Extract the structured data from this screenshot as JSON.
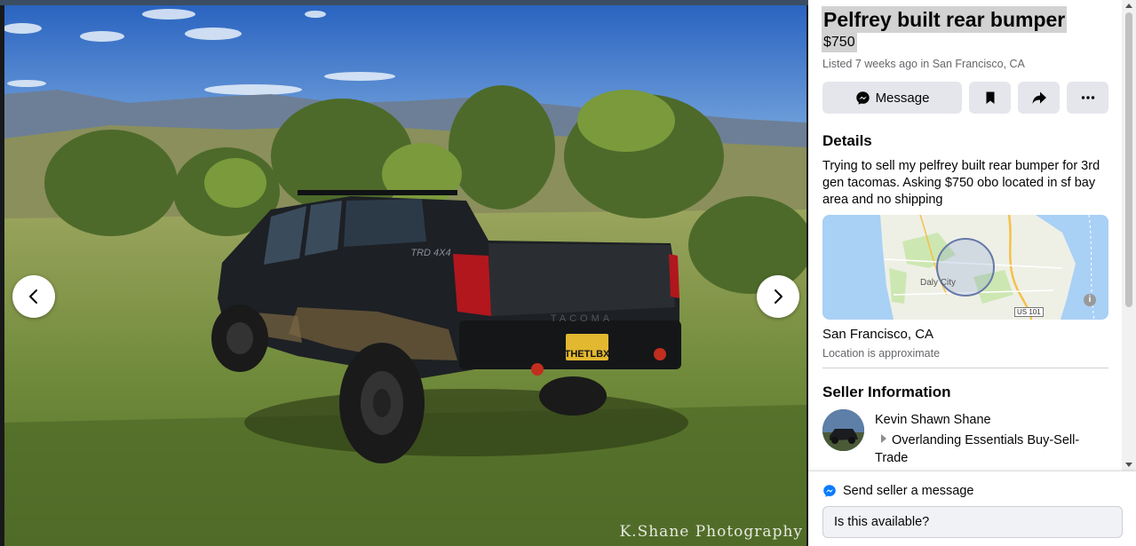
{
  "viewer": {
    "watermark": "K.Shane Photography",
    "plate": "THETLBX",
    "badge_trd": "TRD 4X4",
    "tailgate": "TACOMA",
    "prev_icon": "chevron-left-icon",
    "next_icon": "chevron-right-icon"
  },
  "listing": {
    "title": "Pelfrey built rear bumper",
    "price": "$750",
    "listed": "Listed 7 weeks ago in San Francisco, CA",
    "actions": {
      "message_label": "Message",
      "message_icon": "messenger-icon",
      "save_icon": "bookmark-icon",
      "share_icon": "share-icon",
      "more_icon": "more-icon"
    },
    "details_heading": "Details",
    "details_text": "Trying to sell my pelfrey built rear bumper for 3rd gen tacomas. Asking $750 obo located in sf bay area and no shipping",
    "map": {
      "city_label": "Daly City",
      "highway_badge": "US 101",
      "info_icon": "info-icon"
    },
    "location_name": "San Francisco, CA",
    "location_note": "Location is approximate",
    "seller_heading": "Seller Information",
    "seller_name": "Kevin Shawn Shane",
    "seller_group": "Overlanding Essentials Buy-Sell-Trade"
  },
  "footer": {
    "send_label": "Send seller a message",
    "send_icon": "messenger-icon",
    "input_value": "Is this available?"
  },
  "colors": {
    "button_bg": "#e4e6eb",
    "secondary_text": "#65676b",
    "messenger_blue": "#0a7cff",
    "title_highlight": "#d2d2d2"
  }
}
